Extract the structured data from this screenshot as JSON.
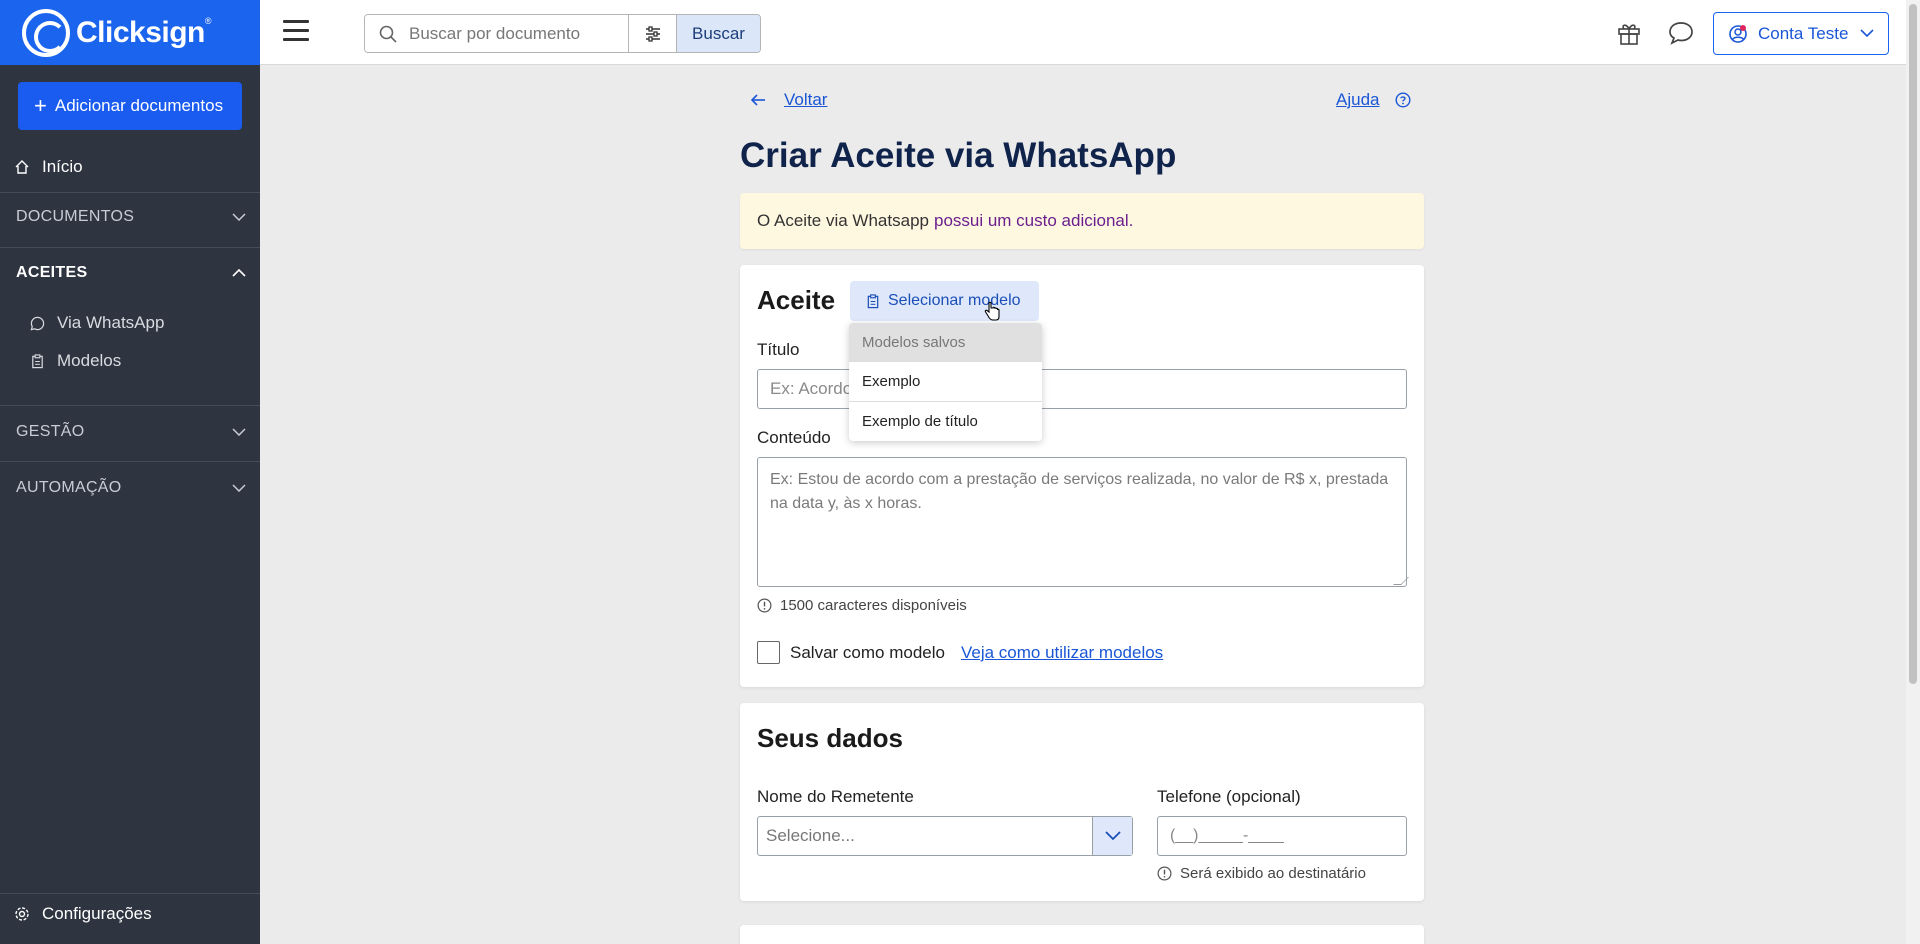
{
  "header": {
    "brand": "Clicksign",
    "brand_mark": "®",
    "search_placeholder": "Buscar por documento",
    "search_button": "Buscar",
    "account_name": "Conta Teste"
  },
  "sidebar": {
    "add_button": "Adicionar documentos",
    "home": "Início",
    "sections": [
      {
        "label": "DOCUMENTOS",
        "expanded": false
      },
      {
        "label": "ACEITES",
        "expanded": true,
        "items": [
          "Via WhatsApp",
          "Modelos"
        ]
      },
      {
        "label": "GESTÃO",
        "expanded": false
      },
      {
        "label": "AUTOMAÇÃO",
        "expanded": false
      }
    ],
    "settings": "Configurações"
  },
  "main": {
    "back": "Voltar",
    "help": "Ajuda",
    "title": "Criar Aceite via WhatsApp",
    "notice_text": "O Aceite via Whatsapp",
    "notice_cost": "possui um custo adicional."
  },
  "aceite": {
    "title": "Aceite",
    "select_model": "Selecionar modelo",
    "dropdown": {
      "header": "Modelos salvos",
      "items": [
        "Exemplo",
        "Exemplo de título"
      ]
    },
    "title_label": "Título",
    "title_placeholder": "Ex: Acordo",
    "content_label": "Conteúdo",
    "content_placeholder": "Ex: Estou de acordo com a prestação de serviços realizada, no valor de R$ x, prestada na data y, às x horas.",
    "chars_available": "1500 caracteres disponíveis",
    "save_model": "Salvar como modelo",
    "how_to_link": "Veja como utilizar modelos"
  },
  "seus_dados": {
    "title": "Seus dados",
    "sender_label": "Nome do Remetente",
    "sender_placeholder": "Selecione...",
    "phone_label": "Telefone (opcional)",
    "phone_placeholder": "(__)_____-____",
    "phone_hint": "Será exibido ao destinatário"
  },
  "colors": {
    "brand": "#1a64ee",
    "sidebar_bg": "#2e3440",
    "notice_bg": "#fff8e1",
    "link": "#1a56d6",
    "title": "#10234b"
  }
}
